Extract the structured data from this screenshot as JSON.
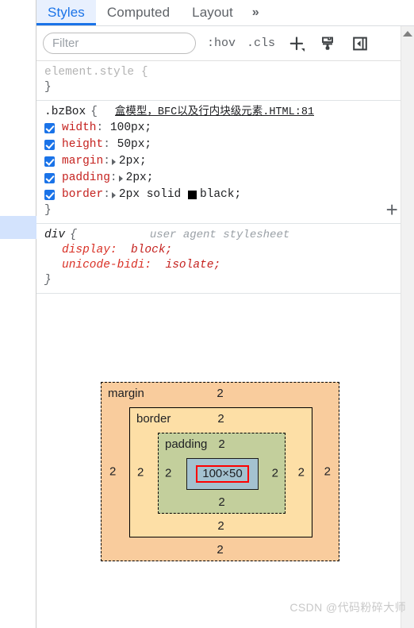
{
  "tabs": [
    {
      "label": "Styles",
      "active": true
    },
    {
      "label": "Computed",
      "active": false
    },
    {
      "label": "Layout",
      "active": false
    }
  ],
  "tabs_overflow_label": "»",
  "toolbar": {
    "filter_placeholder": "Filter",
    "filter_value": "",
    "hov_label": ":hov",
    "cls_label": ".cls",
    "new_rule_icon": "plus-icon",
    "element_state_icon": "paint-roller-icon",
    "sidebar_toggle_icon": "computed-sidebar-toggle-icon"
  },
  "rules": {
    "element_style": {
      "selector": "element.style",
      "open_brace": "{",
      "close_brace": "}"
    },
    "bz_box": {
      "selector": ".bzBox",
      "open_brace": "{",
      "close_brace": "}",
      "origin": "盒模型，BFC以及行内块级元素.HTML:81",
      "declarations": [
        {
          "name": "width",
          "value": "100px;",
          "enabled": true,
          "expandable": false
        },
        {
          "name": "height",
          "value": "50px;",
          "enabled": true,
          "expandable": false
        },
        {
          "name": "margin",
          "value": "2px;",
          "enabled": true,
          "expandable": true
        },
        {
          "name": "padding",
          "value": "2px;",
          "enabled": true,
          "expandable": true
        },
        {
          "name": "border",
          "value": "2px solid",
          "enabled": true,
          "expandable": true,
          "color_swatch": "#000000",
          "color_name": "black;"
        }
      ],
      "add_rule_label": "+"
    },
    "div_ua": {
      "selector": "div",
      "open_brace": "{",
      "close_brace": "}",
      "origin": "user agent stylesheet",
      "declarations": [
        {
          "name": "display",
          "value": "block;"
        },
        {
          "name": "unicode-bidi",
          "value": "isolate;"
        }
      ]
    }
  },
  "box_model": {
    "margin": {
      "label": "margin",
      "top": "2",
      "right": "2",
      "bottom": "2",
      "left": "2",
      "color": "#f9cc9d"
    },
    "border": {
      "label": "border",
      "top": "2",
      "right": "2",
      "bottom": "2",
      "left": "2",
      "color": "#fddfa6"
    },
    "padding": {
      "label": "padding",
      "top": "2",
      "right": "2",
      "bottom": "2",
      "left": "2",
      "color": "#c3cf9c"
    },
    "content": {
      "label": "100×50",
      "color": "#a4c2d0",
      "highlight_color": "#fe0000"
    }
  },
  "watermark": "CSDN @代码粉碎大师"
}
